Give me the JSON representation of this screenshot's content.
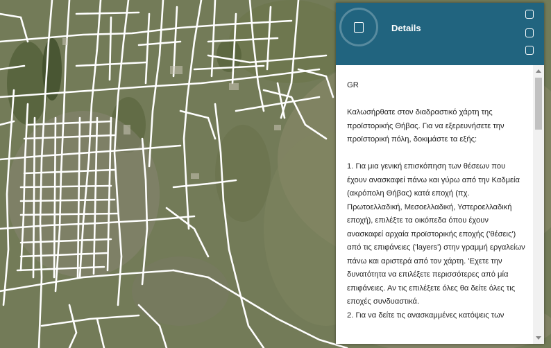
{
  "panel": {
    "title": "Details",
    "icons": [
      "details-icon",
      "window-icon",
      "window-icon",
      "window-icon"
    ],
    "header_color": "#21647f"
  },
  "content": {
    "lang": "GR",
    "intro": "Καλωσήρθατε στον διαδραστικό χάρτη της προϊστορικής Θήβας. Για να εξερευνήσετε την προϊστορική πόλη, δοκιμάστε τα εξής:",
    "step1": "1. Για μια γενική επισκόπηση των θέσεων που έχουν ανασκαφεί πάνω και γύρω από την Καδμεία (ακρόπολη Θήβας) κατά εποχή (πχ. Πρωτοελλαδική, Μεσοελλαδική, Υστεροελλαδική εποχή), επιλέξτε τα οικόπεδα όπου έχουν ανασκαφεί αρχαία προϊστορικής εποχής ('θέσεις') από τις επιφάνειες ('layers') στην γραμμή εργαλείων πάνω και αριστερά από τον χάρτη. 'Εχετε την δυνατότητα να επιλέξετε περισσότερες από μία επιφάνειες.  Αν τις επιλέξετε όλες θα δείτε όλες τις εποχές συνδυαστικά.",
    "step2": "2. Για να δείτε τις ανασκαμμένες κατόψεις των"
  }
}
